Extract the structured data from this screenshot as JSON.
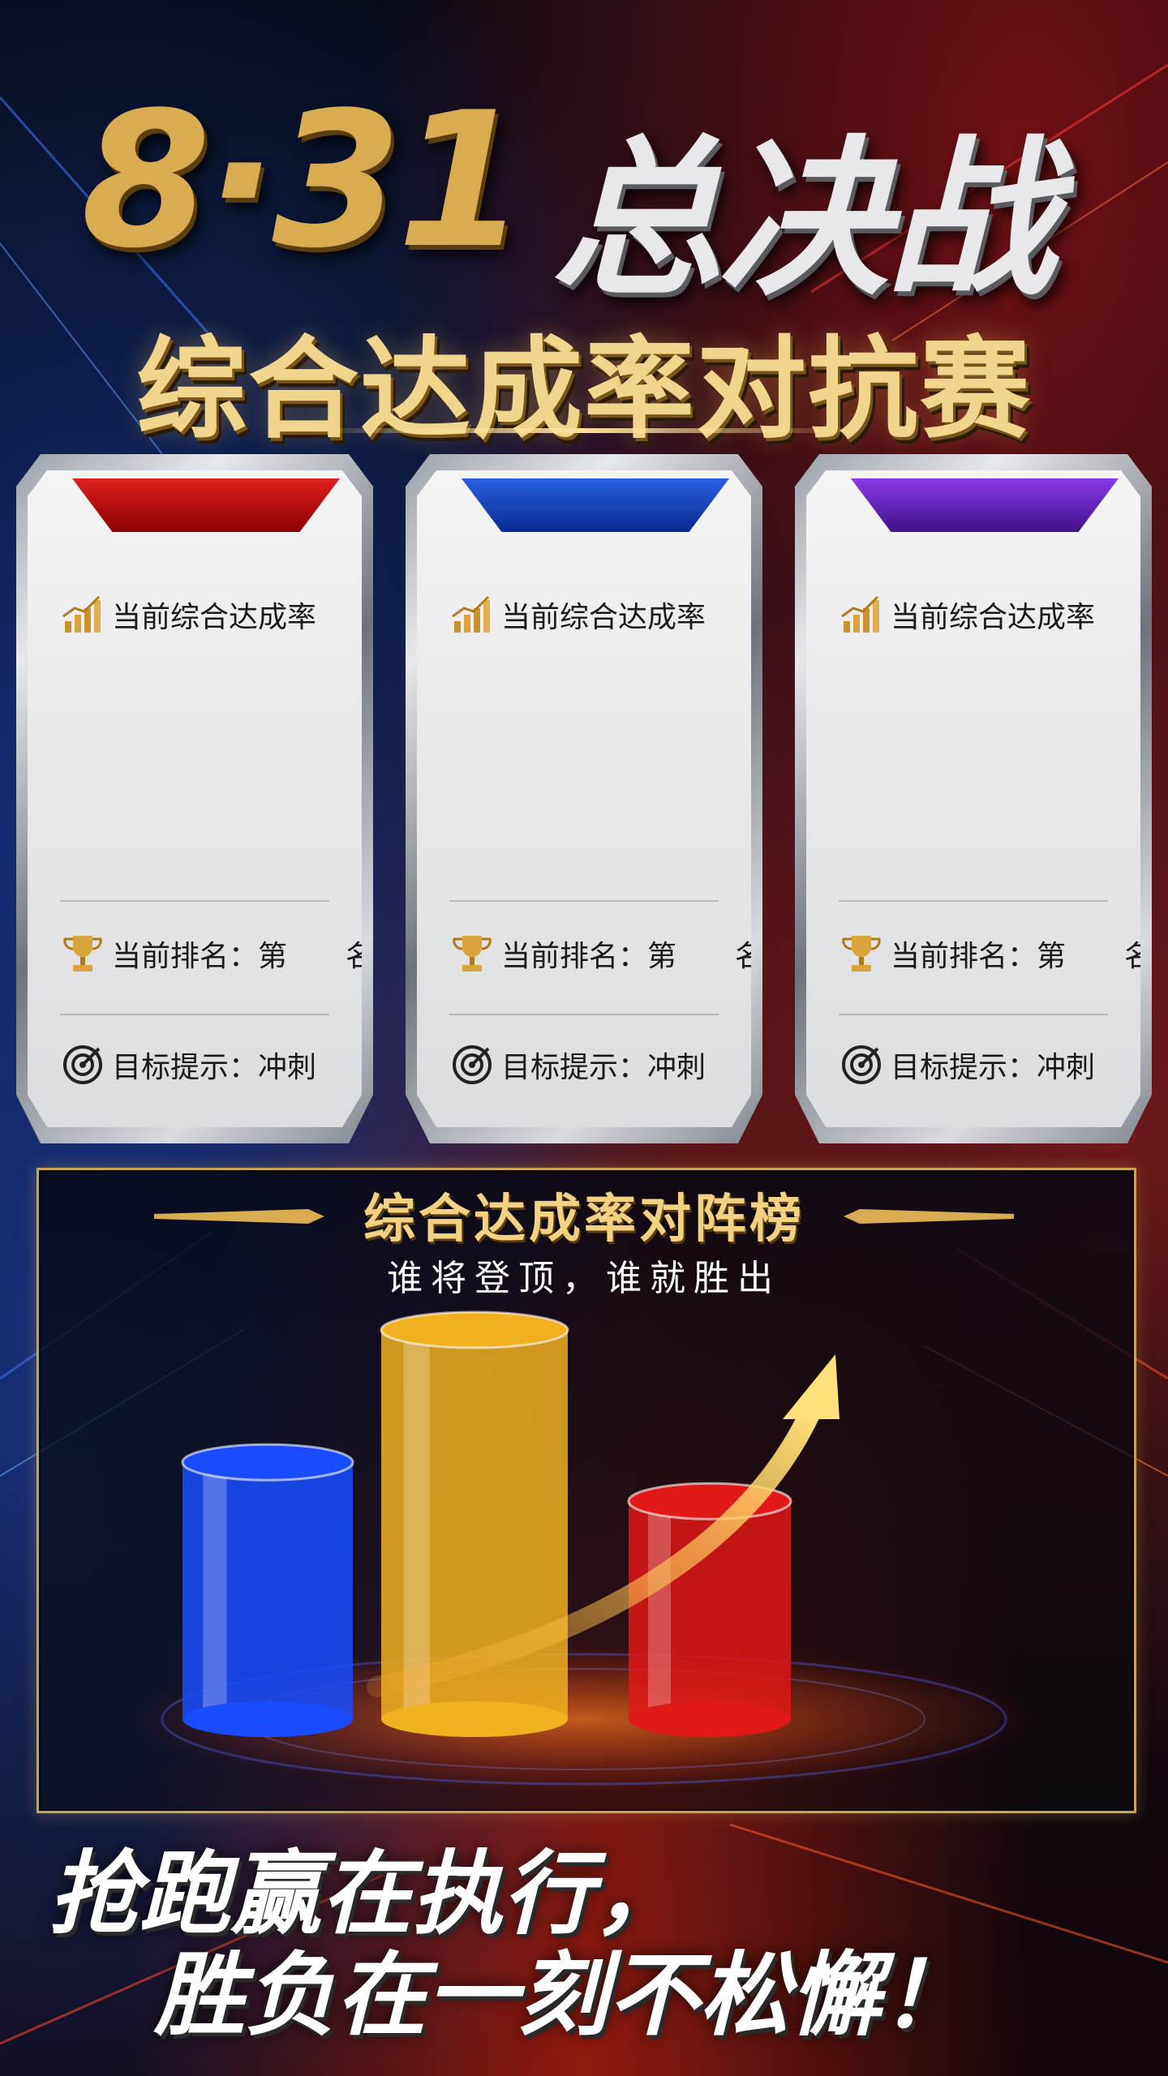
{
  "title": {
    "number": "8·31",
    "text": "总决战"
  },
  "subtitle": "综合达成率对抗赛",
  "cards": [
    {
      "color": "#c01010",
      "rate_label": "当前综合达成率",
      "rank_label": "当前排名：第　　名",
      "goal_label": "目标提示：冲刺"
    },
    {
      "color": "#1a45c8",
      "rate_label": "当前综合达成率",
      "rank_label": "当前排名：第　　名",
      "goal_label": "目标提示：冲刺"
    },
    {
      "color": "#6a22c8",
      "rate_label": "当前综合达成率",
      "rank_label": "当前排名：第　　名",
      "goal_label": "目标提示：冲刺"
    }
  ],
  "ranking": {
    "title": "综合达成率对阵榜",
    "subtitle": "谁将登顶，谁就胜出"
  },
  "chart_data": {
    "type": "bar",
    "categories": [
      "",
      "",
      ""
    ],
    "values": [
      0.66,
      1.0,
      0.56
    ],
    "colors": [
      "#1a4cff",
      "#f0b020",
      "#e01818"
    ]
  },
  "slogan": {
    "line1": "抢跑赢在执行，",
    "line2": "胜负在一刻不松懈！"
  }
}
